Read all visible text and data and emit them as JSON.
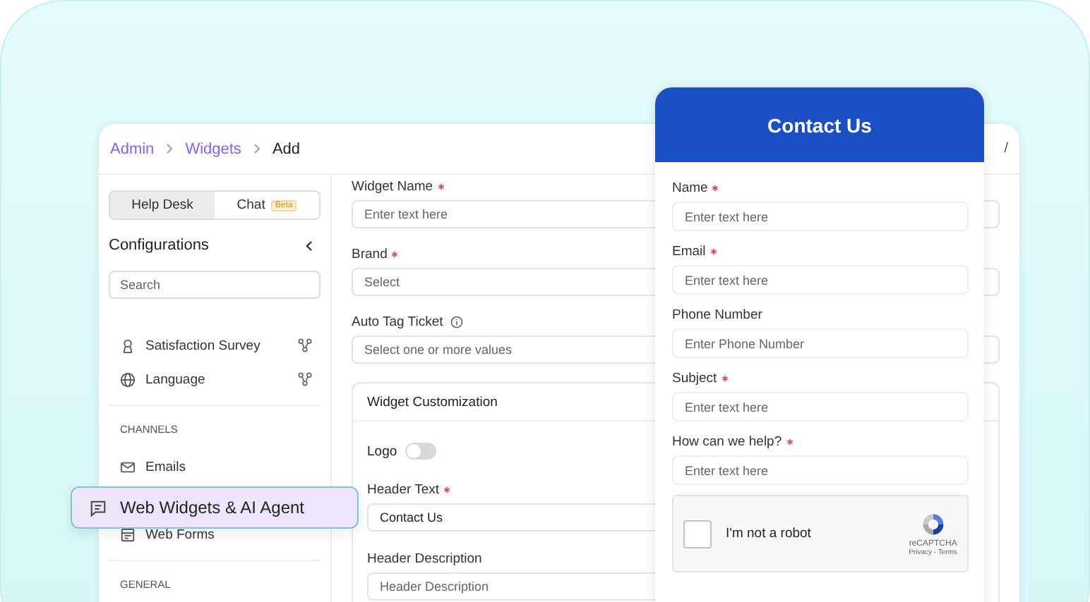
{
  "breadcrumb": [
    {
      "label": "Admin",
      "kind": "link"
    },
    {
      "label": "Widgets",
      "kind": "link"
    },
    {
      "label": "Add",
      "kind": "current"
    }
  ],
  "top_right_text": "/",
  "sidebar": {
    "tabs": [
      {
        "label": "Help Desk",
        "selected": true
      },
      {
        "label": "Chat",
        "selected": false,
        "badge": "Beta"
      }
    ],
    "title": "Configurations",
    "search": {
      "placeholder": "Search"
    },
    "items": [
      {
        "label": "Satisfaction Survey",
        "kind": "award",
        "network": true
      },
      {
        "label": "Language",
        "kind": "globe",
        "network": true
      }
    ],
    "channels": {
      "heading": "CHANNELS",
      "items": [
        {
          "label": "Emails",
          "kind": "mail"
        },
        {
          "label": "Web Forms",
          "kind": "form"
        }
      ]
    },
    "general_heading": "GENERAL"
  },
  "floating_item": {
    "label": "Web Widgets & AI Agent",
    "selected": true
  },
  "form": {
    "fields": [
      {
        "label": "Widget Name",
        "required": true,
        "info": false,
        "placeholder": "Enter text here"
      },
      {
        "label": "Brand",
        "required": true,
        "info": false,
        "placeholder": "Select"
      },
      {
        "label": "Auto Tag Ticket",
        "required": false,
        "info": true,
        "placeholder": "Select one or more values"
      }
    ],
    "customization": {
      "title": "Widget Customization",
      "logo": {
        "label": "Logo",
        "on": false
      },
      "fields": [
        {
          "label": "Header Text",
          "required": true,
          "value": "Contact Us"
        },
        {
          "label": "Header Description",
          "required": false,
          "placeholder": "Header Description"
        }
      ]
    }
  },
  "contact": {
    "title": "Contact Us",
    "fields": [
      {
        "label": "Name",
        "required": true,
        "placeholder": "Enter text here"
      },
      {
        "label": "Email",
        "required": true,
        "placeholder": "Enter text here"
      },
      {
        "label": "Phone Number",
        "required": false,
        "placeholder": "Enter Phone Number"
      },
      {
        "label": "Subject",
        "required": true,
        "placeholder": "Enter text here"
      },
      {
        "label": "How can we help?",
        "required": true,
        "placeholder": "Enter text here"
      }
    ],
    "captcha": {
      "label": "I'm not a robot",
      "checked": false,
      "brand": "reCAPTCHA",
      "links": "Privacy - Terms"
    }
  }
}
